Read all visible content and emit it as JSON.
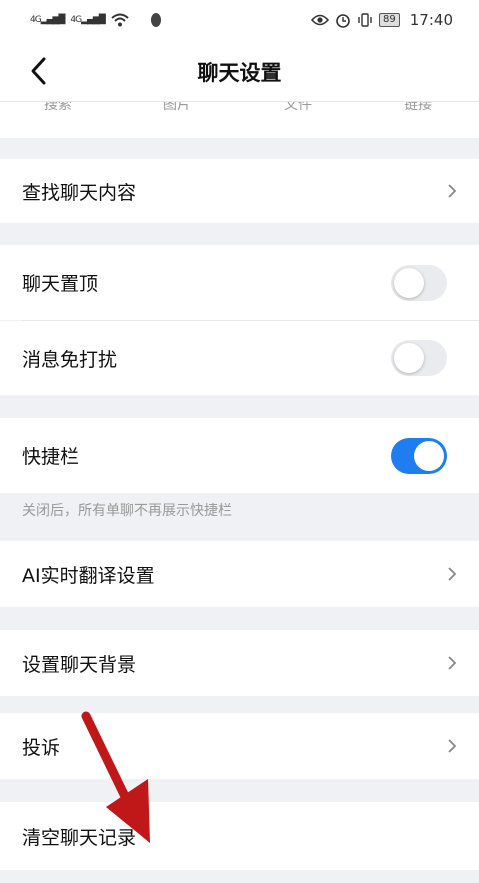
{
  "status_bar": {
    "signal_1": "4G",
    "signal_2": "4G",
    "battery": "89",
    "time": "17:40"
  },
  "header": {
    "title": "聊天设置"
  },
  "tabs": [
    "搜索",
    "图片",
    "文件",
    "链接"
  ],
  "items": {
    "search_chat": "查找聊天内容",
    "pin_chat": "聊天置顶",
    "mute": "消息免打扰",
    "quickbar": "快捷栏",
    "quickbar_hint": "关闭后，所有单聊不再展示快捷栏",
    "ai_translate": "AI实时翻译设置",
    "chat_background": "设置聊天背景",
    "report": "投诉",
    "clear_history": "清空聊天记录"
  },
  "toggles": {
    "pin_chat": false,
    "mute": false,
    "quickbar": true
  },
  "colors": {
    "accent": "#1e7ef0",
    "annotation_arrow": "#c01818"
  }
}
